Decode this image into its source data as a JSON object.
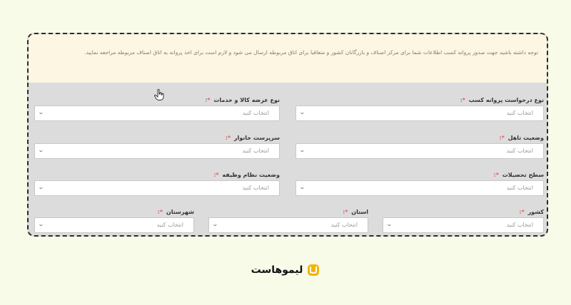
{
  "notice": "توجه داشته باشید جهت صدور پروانه کسب اطلاعات شما برای مرکز اصناف و بازرگانان کشور و متعاقبا برای اتاق مربوطه ارسال می شود و لازم است برای اخذ پروانه به اتاق اصناف مربوطه مراجعه نمایید.",
  "required_mark": "*:",
  "placeholder": "انتخاب کنید",
  "fields": {
    "license_type": "نوع درخواست پروانه کسب",
    "supply_type": "نوع عرضه کالا و خدمات",
    "marital": "وضعیت تاهل",
    "household_head": "سرپرست خانوار",
    "education": "سطح تحصیلات",
    "military": "وضعیت نظام وظیفه",
    "country": "کشور",
    "province": "استان",
    "city": "شهرستان"
  },
  "brand": {
    "name": "لیموهاست"
  },
  "colors": {
    "accent": "#f4b400",
    "required": "#e06060"
  },
  "icons": {
    "dropdown": "chevron-down-icon",
    "cursor": "hand-cursor-icon",
    "logo": "limoo-logo-icon"
  }
}
